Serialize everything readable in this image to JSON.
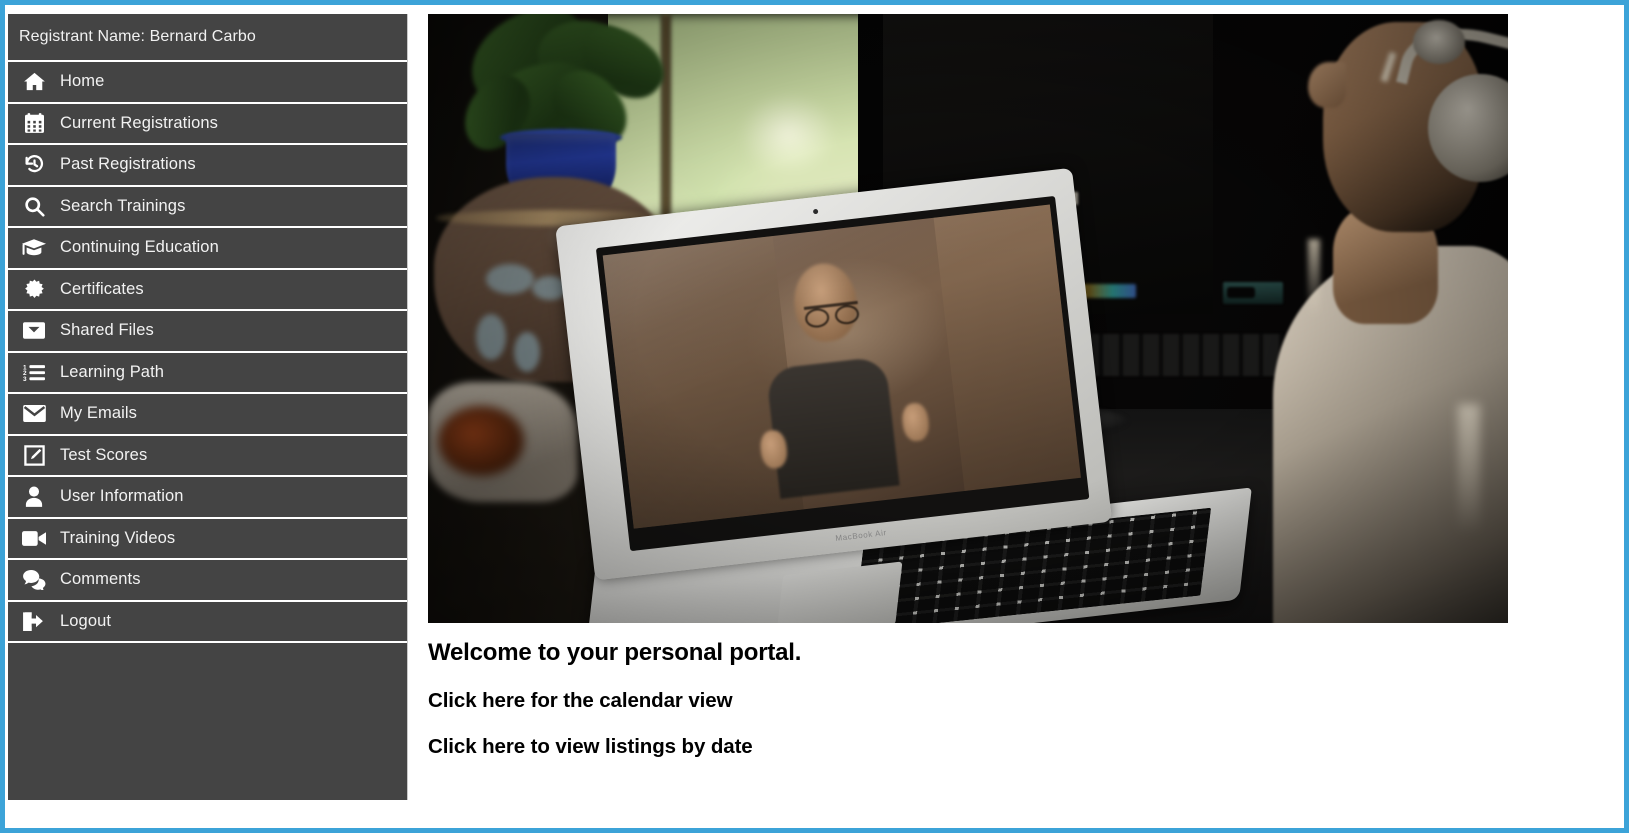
{
  "theme": {
    "frame_border_color": "#3ca3d8",
    "sidebar_bg": "#444444",
    "sidebar_text": "#f2f2f2",
    "separator_color": "#ffffff",
    "content_bg": "#ffffff",
    "heading_color": "#000000"
  },
  "sidebar": {
    "registrant_label": "Registrant Name: Bernard Carbo",
    "items": [
      {
        "label": "Home",
        "icon": "home-icon"
      },
      {
        "label": "Current Registrations",
        "icon": "calendar-icon"
      },
      {
        "label": "Past Registrations",
        "icon": "history-icon"
      },
      {
        "label": "Search Trainings",
        "icon": "search-icon"
      },
      {
        "label": "Continuing Education",
        "icon": "graduation-cap-icon"
      },
      {
        "label": "Certificates",
        "icon": "certificate-seal-icon"
      },
      {
        "label": "Shared Files",
        "icon": "inbox-icon"
      },
      {
        "label": "Learning Path",
        "icon": "numbered-list-icon"
      },
      {
        "label": "My Emails",
        "icon": "envelope-icon"
      },
      {
        "label": "Test Scores",
        "icon": "edit-square-icon"
      },
      {
        "label": "User Information",
        "icon": "user-icon"
      },
      {
        "label": "Training Videos",
        "icon": "video-camera-icon"
      },
      {
        "label": "Comments",
        "icon": "comments-icon"
      },
      {
        "label": "Logout",
        "icon": "sign-out-icon"
      }
    ]
  },
  "main": {
    "hero_alt": "Person wearing headphones watching a video call on a MacBook Air laptop beside a potted plant by a window",
    "welcome_heading": "Welcome to your personal portal.",
    "links": [
      {
        "label": "Click here for the calendar view"
      },
      {
        "label": "Click here to view listings by date"
      }
    ]
  }
}
